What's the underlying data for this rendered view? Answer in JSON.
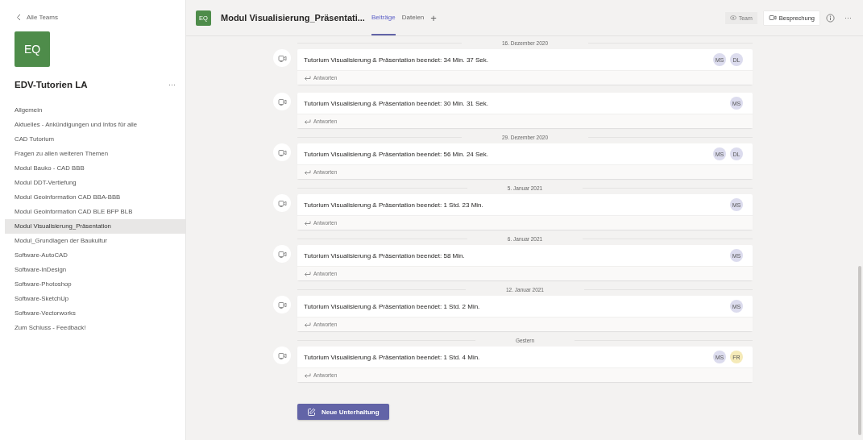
{
  "sidebar": {
    "back_label": "Alle Teams",
    "team_avatar": "EQ",
    "team_name": "EDV-Tutorien LA",
    "more": "···",
    "channels": [
      {
        "label": "Allgemein",
        "selected": false
      },
      {
        "label": "Aktuelles - Ankündigungen und Infos für alle",
        "selected": false
      },
      {
        "label": "CAD Tutorium",
        "selected": false
      },
      {
        "label": "Fragen zu allen weiteren Themen",
        "selected": false
      },
      {
        "label": "Modul Bauko - CAD BBB",
        "selected": false
      },
      {
        "label": "Modul DDT-Vertiefung",
        "selected": false
      },
      {
        "label": "Modul Geoinformation CAD BBA-BBB",
        "selected": false
      },
      {
        "label": "Modul Geoinformation CAD BLE BFP BLB",
        "selected": false
      },
      {
        "label": "Modul Visualisierung_Präsentation",
        "selected": true
      },
      {
        "label": "Modul_Grundlagen der Baukultur",
        "selected": false
      },
      {
        "label": "Software-AutoCAD",
        "selected": false
      },
      {
        "label": "Software-InDesign",
        "selected": false
      },
      {
        "label": "Software-Photoshop",
        "selected": false
      },
      {
        "label": "Software-SketchUp",
        "selected": false
      },
      {
        "label": "Software-Vectorworks",
        "selected": false
      },
      {
        "label": "Zum Schluss - Feedback!",
        "selected": false
      }
    ]
  },
  "header": {
    "avatar": "EQ",
    "title": "Modul Visualisierung_Präsentati...",
    "tabs": [
      {
        "label": "Beiträge",
        "selected": true
      },
      {
        "label": "Dateien",
        "selected": false
      }
    ],
    "add": "+",
    "team_button": "Team",
    "meeting_button": "Besprechung",
    "more": "···"
  },
  "feed": [
    {
      "kind": "date",
      "text": "16. Dezember 2020"
    },
    {
      "kind": "post",
      "title": "Tutorium Visualisierung & Präsentation beendet: 34 Min. 37 Sek.",
      "reply": "Antworten",
      "avatars": [
        {
          "initials": "MS",
          "color": "#dcdcee"
        },
        {
          "initials": "DL",
          "color": "#dcdcee"
        }
      ]
    },
    {
      "kind": "post",
      "title": "Tutorium Visualisierung & Präsentation beendet: 30 Min. 31 Sek.",
      "reply": "Antworten",
      "avatars": [
        {
          "initials": "MS",
          "color": "#dcdcee"
        }
      ]
    },
    {
      "kind": "date",
      "text": "29. Dezember 2020"
    },
    {
      "kind": "post",
      "title": "Tutorium Visualisierung & Präsentation beendet: 56 Min. 24 Sek.",
      "reply": "Antworten",
      "avatars": [
        {
          "initials": "MS",
          "color": "#dcdcee"
        },
        {
          "initials": "DL",
          "color": "#dcdcee"
        }
      ]
    },
    {
      "kind": "date",
      "text": "5. Januar 2021"
    },
    {
      "kind": "post",
      "title": "Tutorium Visualisierung & Präsentation beendet: 1 Std. 23 Min.",
      "reply": "Antworten",
      "avatars": [
        {
          "initials": "MS",
          "color": "#dcdcee"
        }
      ]
    },
    {
      "kind": "date",
      "text": "6. Januar 2021"
    },
    {
      "kind": "post",
      "title": "Tutorium Visualisierung & Präsentation beendet: 58 Min.",
      "reply": "Antworten",
      "avatars": [
        {
          "initials": "MS",
          "color": "#dcdcee"
        }
      ]
    },
    {
      "kind": "date",
      "text": "12. Januar 2021"
    },
    {
      "kind": "post",
      "title": "Tutorium Visualisierung & Präsentation beendet: 1 Std. 2 Min.",
      "reply": "Antworten",
      "avatars": [
        {
          "initials": "MS",
          "color": "#dcdcee"
        }
      ]
    },
    {
      "kind": "date",
      "text": "Gestern"
    },
    {
      "kind": "post",
      "title": "Tutorium Visualisierung & Präsentation beendet: 1 Std. 4 Min.",
      "reply": "Antworten",
      "avatars": [
        {
          "initials": "MS",
          "color": "#dcdcee"
        },
        {
          "initials": "FR",
          "color": "#f5eab8"
        }
      ]
    }
  ],
  "new_conversation": "Neue Unterhaltung"
}
